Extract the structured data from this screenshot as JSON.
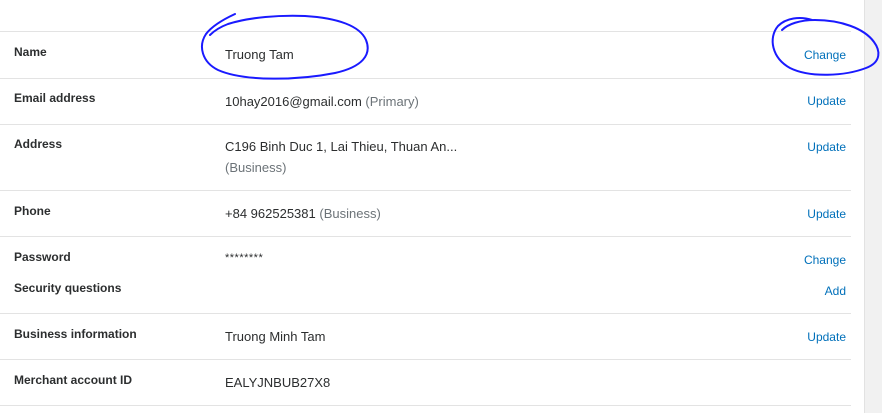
{
  "rows": [
    {
      "label": "Name",
      "value": "Truong Tam",
      "action": "Change"
    },
    {
      "label": "Email address",
      "value": "10hay2016@gmail.com",
      "note": "(Primary)",
      "action": "Update"
    },
    {
      "label": "Address",
      "value": "C196 Binh Duc 1, Lai Thieu, Thuan An...",
      "note": "(Business)",
      "action": "Update"
    },
    {
      "label": "Phone",
      "value": "+84 962525381",
      "note": "(Business)",
      "action": "Update"
    },
    {
      "label": "Password",
      "value": "********",
      "action": "Change"
    },
    {
      "label": "Security questions",
      "action": "Add"
    },
    {
      "label": "Business information",
      "value": "Truong Minh Tam",
      "action": "Update"
    },
    {
      "label": "Merchant account ID",
      "value": "EALYJNBUB27X8"
    }
  ],
  "annotation_color": "#1a1aff"
}
